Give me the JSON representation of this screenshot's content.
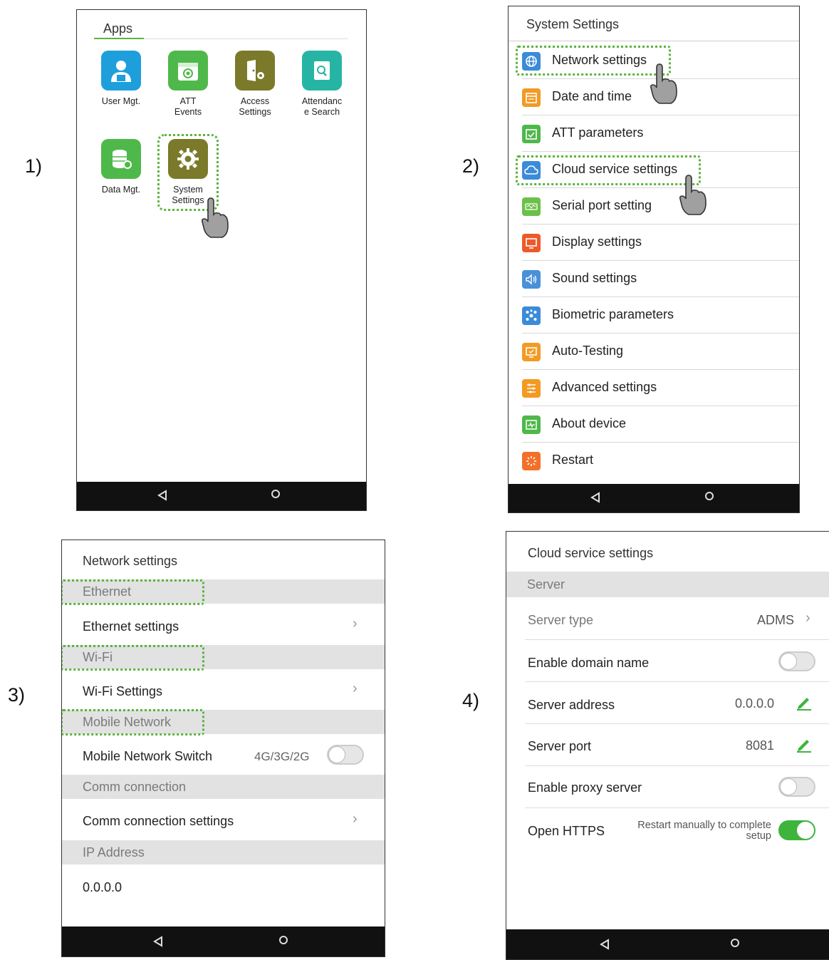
{
  "steps": {
    "s1": "1)",
    "s2": "2)",
    "s3": "3)",
    "s4": "4)"
  },
  "screen1": {
    "title": "Apps",
    "apps": [
      {
        "label_l1": "User Mgt.",
        "label_l2": "",
        "icon": "user-mgt-icon",
        "color": "#1e9fdc"
      },
      {
        "label_l1": "ATT",
        "label_l2": "Events",
        "icon": "att-events-icon",
        "color": "#4fb84a"
      },
      {
        "label_l1": "Access",
        "label_l2": "Settings",
        "icon": "access-settings-icon",
        "color": "#7a7a2a"
      },
      {
        "label_l1": "Attendanc",
        "label_l2": "e Search",
        "icon": "attendance-search-icon",
        "color": "#26b5a5"
      },
      {
        "label_l1": "Data Mgt.",
        "label_l2": "",
        "icon": "data-mgt-icon",
        "color": "#4fb84a"
      },
      {
        "label_l1": "System",
        "label_l2": "Settings",
        "icon": "system-settings-icon",
        "color": "#7a7a2a"
      }
    ]
  },
  "screen2": {
    "title": "System Settings",
    "items": [
      {
        "label": "Network settings",
        "icon": "network-icon",
        "color": "#3b8bd8"
      },
      {
        "label": "Date and time",
        "icon": "calendar-icon",
        "color": "#f39a23"
      },
      {
        "label": "ATT parameters",
        "icon": "att-parameters-icon",
        "color": "#4fb84a"
      },
      {
        "label": "Cloud service settings",
        "icon": "cloud-icon",
        "color": "#3b8bd8"
      },
      {
        "label": "Serial port setting",
        "icon": "serial-port-icon",
        "color": "#6cc04a"
      },
      {
        "label": "Display settings",
        "icon": "display-icon",
        "color": "#ec5a2a"
      },
      {
        "label": "Sound settings",
        "icon": "sound-icon",
        "color": "#4a90d9"
      },
      {
        "label": "Biometric parameters",
        "icon": "biometric-icon",
        "color": "#3b8bd8"
      },
      {
        "label": "Auto-Testing",
        "icon": "auto-testing-icon",
        "color": "#f39a23"
      },
      {
        "label": "Advanced settings",
        "icon": "advanced-settings-icon",
        "color": "#f39a23"
      },
      {
        "label": "About device",
        "icon": "about-device-icon",
        "color": "#4fb84a"
      },
      {
        "label": "Restart",
        "icon": "restart-icon",
        "color": "#f3702a"
      }
    ]
  },
  "screen3": {
    "title": "Network settings",
    "sec_ethernet": "Ethernet",
    "ethernet_settings": "Ethernet settings",
    "sec_wifi": "Wi-Fi",
    "wifi_settings": "Wi-Fi Settings",
    "sec_mobile": "Mobile Network",
    "mobile_switch": "Mobile Network Switch",
    "mobile_mode": "4G/3G/2G",
    "mobile_switch_on": false,
    "sec_comm": "Comm connection",
    "comm_settings": "Comm connection settings",
    "sec_ip": "IP Address",
    "ip_value": "0.0.0.0"
  },
  "screen4": {
    "title": "Cloud service settings",
    "sec_server": "Server",
    "server_type_label": "Server type",
    "server_type_value": "ADMS",
    "enable_domain_label": "Enable domain name",
    "enable_domain_on": false,
    "server_address_label": "Server address",
    "server_address_value": "0.0.0.0",
    "server_port_label": "Server port",
    "server_port_value": "8081",
    "enable_proxy_label": "Enable proxy server",
    "enable_proxy_on": false,
    "https_label": "Open HTTPS",
    "https_note_l1": "Restart manually to complete",
    "https_note_l2": "setup",
    "https_on": true
  },
  "colors": {
    "accent_green": "#5ab43c",
    "toggle_on": "#3db53d",
    "navbar": "#111111"
  }
}
